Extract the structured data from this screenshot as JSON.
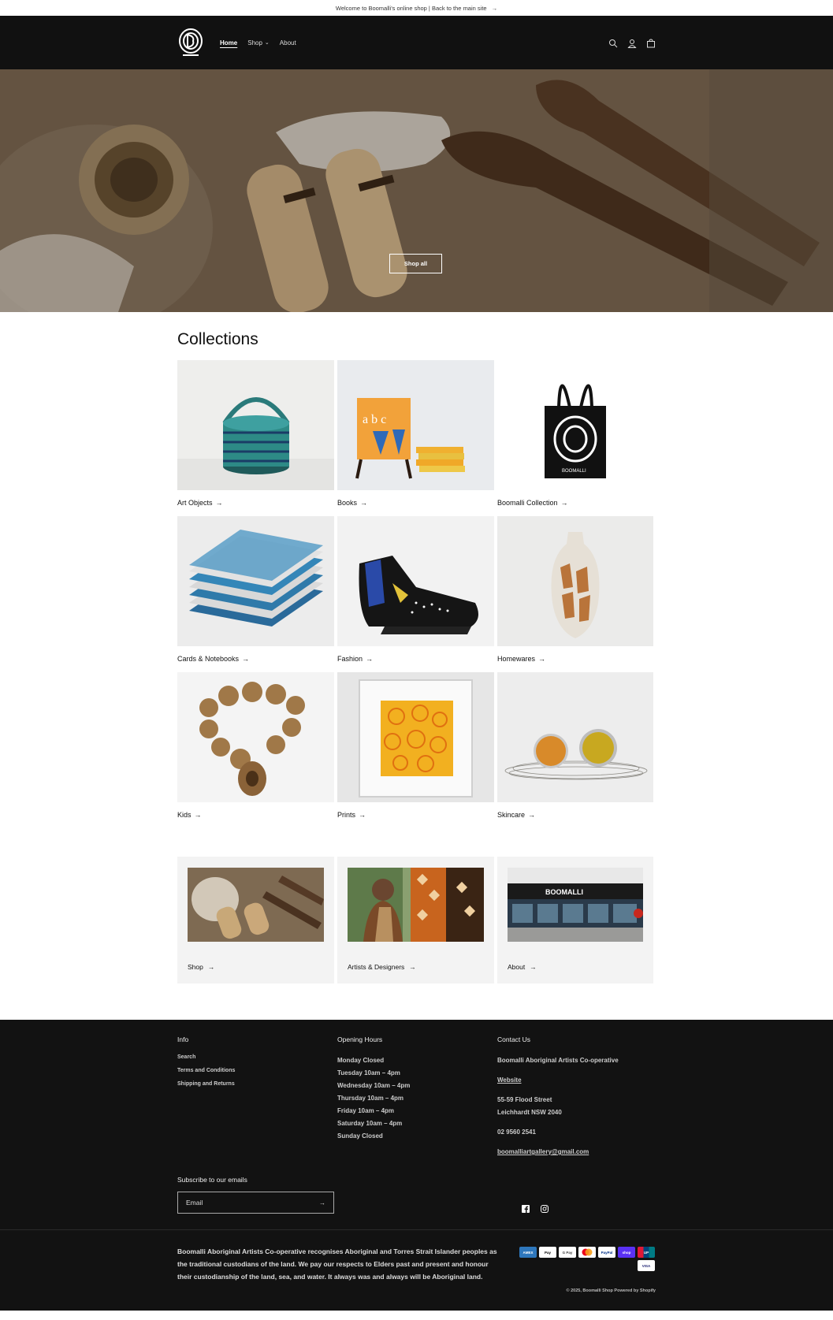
{
  "announcement": {
    "text": "Welcome to Boomalli's online shop | Back to the main site"
  },
  "header": {
    "logo_label": "BOOMALLI",
    "nav": [
      {
        "label": "Home",
        "active": true
      },
      {
        "label": "Shop",
        "has_dropdown": true
      },
      {
        "label": "About"
      }
    ],
    "icons": [
      "search-icon",
      "account-icon",
      "cart-icon"
    ]
  },
  "hero": {
    "button_label": "Shop all"
  },
  "collections": {
    "title": "Collections",
    "items": [
      {
        "label": "Art Objects"
      },
      {
        "label": "Books"
      },
      {
        "label": "Boomalli Collection"
      },
      {
        "label": "Cards & Notebooks"
      },
      {
        "label": "Fashion"
      },
      {
        "label": "Homewares"
      },
      {
        "label": "Kids"
      },
      {
        "label": "Prints"
      },
      {
        "label": "Skincare"
      }
    ]
  },
  "promo": [
    {
      "label": "Shop"
    },
    {
      "label": "Artists & Designers"
    },
    {
      "label": "About"
    }
  ],
  "footer": {
    "info": {
      "title": "Info",
      "links": [
        "Search",
        "Terms and Conditions",
        "Shipping and Returns"
      ]
    },
    "hours": {
      "title": "Opening Hours",
      "lines": [
        "Monday Closed",
        "Tuesday 10am – 4pm",
        "Wednesday 10am – 4pm",
        "Thursday 10am – 4pm",
        "Friday 10am – 4pm",
        "Saturday 10am – 4pm",
        "Sunday Closed"
      ]
    },
    "contact": {
      "title": "Contact Us",
      "org": "Boomalli Aboriginal Artists Co-operative",
      "website": "Website",
      "address1": "55-59 Flood Street",
      "address2": "Leichhardt NSW 2040",
      "phone": "02 9560 2541",
      "email": "boomalliartgallery@gmail.com"
    },
    "subscribe": {
      "title": "Subscribe to our emails",
      "placeholder": "Email"
    },
    "acknowledgement": "Boomalli Aboriginal Artists Co-operative recognises Aboriginal and Torres Strait Islander peoples as the traditional custodians of the land. We pay our respects to Elders past and present and honour their custodianship of the land, sea, and water. It always was and always will be Aboriginal land.",
    "payments": [
      "American Express",
      "Apple Pay",
      "Google Pay",
      "Mastercard",
      "PayPal",
      "Shop Pay",
      "Union Pay",
      "Visa"
    ],
    "payment_labels": [
      "AMEX",
      "Pay",
      "G Pay",
      "",
      "PayPal",
      "shop",
      "UP",
      "VISA"
    ],
    "copyright": "© 2025, Boomalli Shop Powered by Shopify"
  }
}
